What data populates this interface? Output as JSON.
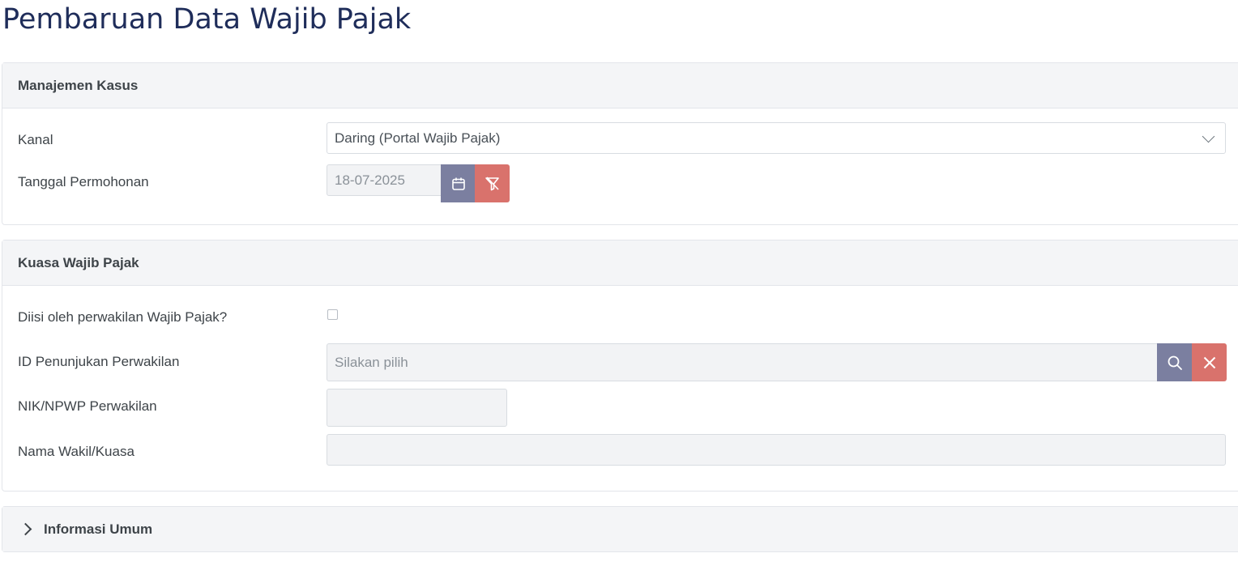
{
  "page": {
    "title": "Pembaruan Data Wajib Pajak"
  },
  "manajemen_kasus": {
    "header": "Manajemen Kasus",
    "kanal": {
      "label": "Kanal",
      "value": "Daring (Portal Wajib Pajak)"
    },
    "tanggal": {
      "label": "Tanggal Permohonan",
      "value": "18-07-2025"
    }
  },
  "kuasa": {
    "header": "Kuasa Wajib Pajak",
    "diisi": {
      "label": "Diisi oleh perwakilan Wajib Pajak?",
      "checked": false
    },
    "id_penunjukan": {
      "label": "ID Penunjukan Perwakilan",
      "placeholder": "Silakan pilih"
    },
    "nik": {
      "label": "NIK/NPWP Perwakilan",
      "value": ""
    },
    "nama": {
      "label": "Nama Wakil/Kuasa",
      "value": ""
    }
  },
  "informasi_umum": {
    "header": "Informasi Umum"
  },
  "icons": {
    "calendar": "calendar-icon",
    "clear_filter": "filter-clear-icon",
    "search": "search-icon",
    "close": "close-icon",
    "chevron_down": "chevron-down-icon",
    "chevron_right": "chevron-right-icon"
  },
  "colors": {
    "title": "#1f2d5a",
    "calendar_button": "#7b7fa0",
    "danger_button": "#d9726c",
    "header_bg": "#f4f5f7"
  }
}
